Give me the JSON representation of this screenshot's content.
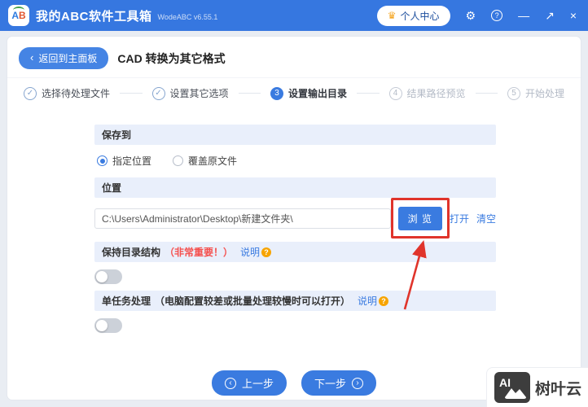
{
  "titlebar": {
    "logo": {
      "a": "A",
      "b": "B"
    },
    "title": "我的ABC软件工具箱",
    "version": "WodeABC v6.55.1",
    "user_center": "个人中心"
  },
  "icons": {
    "crown": "♛",
    "gear": "⚙",
    "help": "?",
    "minimize": "—",
    "resize": "↗",
    "close": "×",
    "back": "‹",
    "check": "✓",
    "prev": "‹",
    "next": "›",
    "help_q": "?"
  },
  "breadcrumb": {
    "back": "返回到主面板",
    "title": "CAD 转换为其它格式"
  },
  "steps": [
    {
      "label": "选择待处理文件",
      "state": "done"
    },
    {
      "label": "设置其它选项",
      "state": "done"
    },
    {
      "num": "3",
      "label": "设置输出目录",
      "state": "active"
    },
    {
      "num": "4",
      "label": "结果路径预览",
      "state": "pending"
    },
    {
      "num": "5",
      "label": "开始处理",
      "state": "pending"
    }
  ],
  "save_to": {
    "header": "保存到",
    "options": [
      {
        "label": "指定位置",
        "selected": true
      },
      {
        "label": "覆盖原文件",
        "selected": false
      }
    ]
  },
  "location": {
    "header": "位置",
    "path": "C:\\Users\\Administrator\\Desktop\\新建文件夹\\",
    "browse": "浏 览",
    "open": "打开",
    "clear": "清空"
  },
  "keep_structure": {
    "title": "保持目录结构",
    "important": "（非常重要！）",
    "help": "说明",
    "enabled": false
  },
  "single_task": {
    "title": "单任务处理",
    "hint": "（电脑配置较差或批量处理较慢时可以打开）",
    "help": "说明",
    "enabled": false
  },
  "footer": {
    "prev": "上一步",
    "next": "下一步"
  },
  "watermark": {
    "ai": "AI",
    "brand": "树叶云"
  },
  "colors": {
    "titlebar": "#3677e0",
    "accent": "#3a7be0",
    "section_bg": "#e9effb",
    "annotation": "#e0342b",
    "important_red": "#f5504e",
    "help_icon": "#f7a400"
  }
}
